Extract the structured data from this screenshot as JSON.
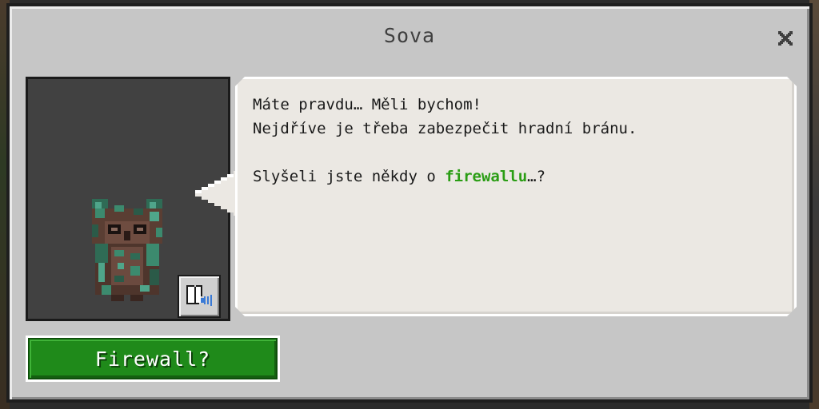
{
  "dialog": {
    "title": "Sova",
    "close_icon": "close-icon"
  },
  "portrait": {
    "character_icon": "owl-character-icon",
    "audio_button_icon": "book-audio-icon"
  },
  "speech": {
    "line1": "Máte pravdu… Měli bychom!",
    "line2": "Nejdříve je třeba zabezpečit hradní bránu.",
    "line3_prefix": "Slyšeli jste někdy o ",
    "line3_highlight": "firewallu",
    "line3_suffix": "…?"
  },
  "action": {
    "label": "Firewall?"
  },
  "colors": {
    "highlight": "#2a9d14",
    "button_green": "#1f8a1a",
    "panel_gray": "#c6c6c6",
    "bubble_bg": "#ebe8e3"
  }
}
